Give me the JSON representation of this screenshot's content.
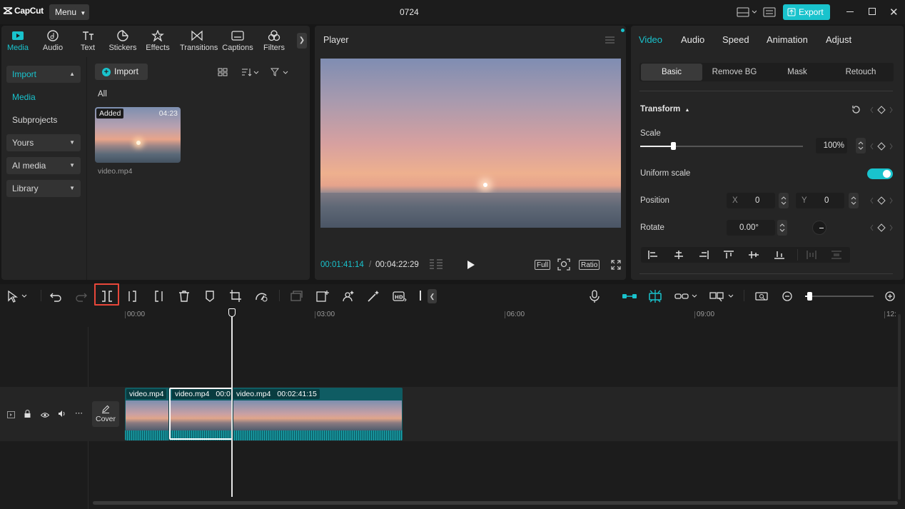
{
  "app": {
    "logo": "CapCut",
    "menu_label": "Menu",
    "project_title": "0724",
    "export_label": "Export"
  },
  "nav_tabs": [
    {
      "label": "Media",
      "icon": "media-icon",
      "active": true
    },
    {
      "label": "Audio",
      "icon": "audio-icon"
    },
    {
      "label": "Text",
      "icon": "text-icon"
    },
    {
      "label": "Stickers",
      "icon": "stickers-icon"
    },
    {
      "label": "Effects",
      "icon": "effects-icon"
    },
    {
      "label": "Transitions",
      "icon": "transitions-icon"
    },
    {
      "label": "Captions",
      "icon": "captions-icon"
    },
    {
      "label": "Filters",
      "icon": "filters-icon"
    }
  ],
  "sidebar": {
    "import": "Import",
    "media": "Media",
    "subprojects": "Subprojects",
    "yours": "Yours",
    "ai_media": "AI media",
    "library": "Library"
  },
  "media": {
    "import_button": "Import",
    "filter_all": "All",
    "item": {
      "badge": "Added",
      "duration": "04:23",
      "filename": "video.mp4"
    }
  },
  "player": {
    "title": "Player",
    "current_time": "00:01:41:14",
    "total_time": "00:04:22:29",
    "full_label": "Full",
    "ratio_label": "Ratio"
  },
  "inspector": {
    "tabs": [
      "Video",
      "Audio",
      "Speed",
      "Animation",
      "Adjust"
    ],
    "subtabs": [
      "Basic",
      "Remove BG",
      "Mask",
      "Retouch"
    ],
    "transform_label": "Transform",
    "scale_label": "Scale",
    "scale_value": "100%",
    "scale_level": 0.2,
    "uniform_scale_label": "Uniform scale",
    "uniform_scale_on": true,
    "position_label": "Position",
    "x_label": "X",
    "x_value": "0",
    "y_label": "Y",
    "y_value": "0",
    "rotate_label": "Rotate",
    "rotate_value": "0.00°"
  },
  "timeline": {
    "ticks": [
      "00:00",
      "03:00",
      "06:00",
      "09:00",
      "12:"
    ],
    "cover_label": "Cover",
    "clips": [
      {
        "name": "video.mp4",
        "duration": ""
      },
      {
        "name": "video.mp4",
        "duration": "00:0"
      },
      {
        "name": "video.mp4",
        "duration": "00:02:41:15"
      }
    ]
  },
  "colors": {
    "accent": "#19c3cd",
    "highlight_box": "#e8473a",
    "panel": "#252525",
    "background": "#171717"
  }
}
